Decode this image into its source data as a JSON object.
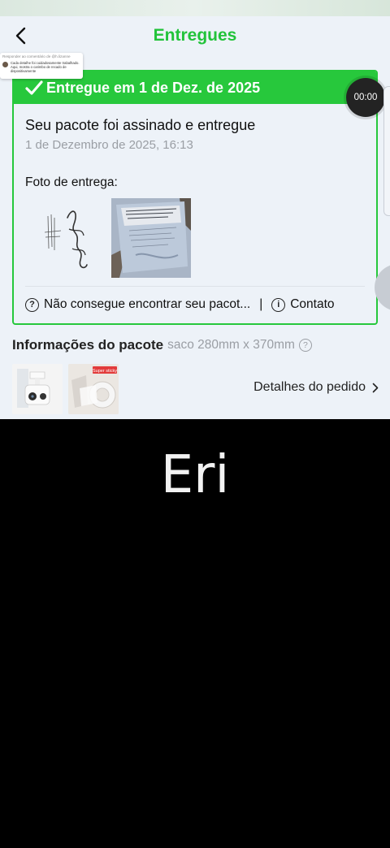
{
  "header": {
    "title": "Entregues"
  },
  "comment_bubble": {
    "reply_to": "Responder ao comentário de @h.lizanne",
    "text": "Cada detalhe foi cuidadosamente trabalhado. Aqui, mostra o carimbo de recado de dispositivamente"
  },
  "status_card": {
    "banner": "Entregue em 1 de Dez. de 2025",
    "title": "Seu pacote foi assinado e entregue",
    "date": "1 de Dezembro de 2025, 16:13",
    "photo_label": "Foto de entrega:",
    "help_link": "Não consegue encontrar seu pacot...",
    "separator": "|",
    "contact_link": "Contato"
  },
  "timer": "00:00",
  "package": {
    "title": "Informações do pacote",
    "size": "saco 280mm x 370mm",
    "sticker_label": "Super sticky",
    "order_details": "Detalhes do pedido"
  },
  "caption": "Eri",
  "colors": {
    "accent": "#27c83c",
    "title_green": "#22c33a",
    "background": "#edf2f8"
  }
}
